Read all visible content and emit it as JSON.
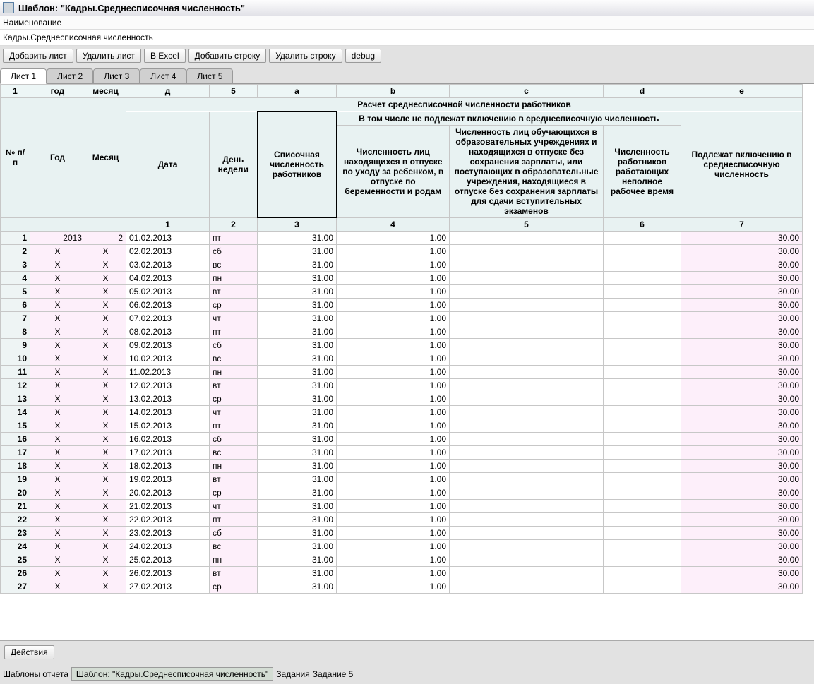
{
  "title": "Шаблон: \"Кадры.Среднесписочная численность\"",
  "name_label": "Наименование",
  "name_value": "Кадры.Среднесписочная численность",
  "toolbar": {
    "add_sheet": "Добавить лист",
    "del_sheet": "Удалить лист",
    "excel": "В Excel",
    "add_row": "Добавить строку",
    "del_row": "Удалить строку",
    "debug": "debug"
  },
  "tabs": [
    "Лист 1",
    "Лист 2",
    "Лист 3",
    "Лист 4",
    "Лист 5"
  ],
  "active_tab": 0,
  "column_letters": [
    "1",
    "год",
    "месяц",
    "д",
    "5",
    "a",
    "b",
    "c",
    "d",
    "e"
  ],
  "main_title": "Расчет среднесписочной численности работников",
  "group_bc_d": "В том числе не подлежат включению в среднесписочную численность",
  "headers": {
    "np": "№ п/п",
    "year": "Год",
    "month": "Месяц",
    "date": "Дата",
    "dow": "День недели",
    "a": "Списочная численность работников",
    "b": "Численность лиц находящихся в отпуске по уходу за ребенком, в отпуске по беременности и родам",
    "c": "Численность лиц обучающихся в образовательных учреждениях и находящихся в отпуске без сохранения зарплаты, или поступающих в образовательные учреждения, находящиеся в отпуске без сохранения зарплаты для сдачи вступительных экзаменов",
    "d": "Численность работников работающих неполное рабочее время",
    "e": "Подлежат включению в среднесписочную численность"
  },
  "subnums": [
    "1",
    "2",
    "3",
    "4",
    "5",
    "6",
    "7"
  ],
  "rows": [
    {
      "n": 1,
      "year": "2013",
      "month": "2",
      "date": "01.02.2013",
      "dow": "пт",
      "a": "31.00",
      "b": "1.00",
      "c": "",
      "d": "",
      "e": "30.00"
    },
    {
      "n": 2,
      "year": "X",
      "month": "X",
      "date": "02.02.2013",
      "dow": "сб",
      "a": "31.00",
      "b": "1.00",
      "c": "",
      "d": "",
      "e": "30.00"
    },
    {
      "n": 3,
      "year": "X",
      "month": "X",
      "date": "03.02.2013",
      "dow": "вс",
      "a": "31.00",
      "b": "1.00",
      "c": "",
      "d": "",
      "e": "30.00"
    },
    {
      "n": 4,
      "year": "X",
      "month": "X",
      "date": "04.02.2013",
      "dow": "пн",
      "a": "31.00",
      "b": "1.00",
      "c": "",
      "d": "",
      "e": "30.00"
    },
    {
      "n": 5,
      "year": "X",
      "month": "X",
      "date": "05.02.2013",
      "dow": "вт",
      "a": "31.00",
      "b": "1.00",
      "c": "",
      "d": "",
      "e": "30.00"
    },
    {
      "n": 6,
      "year": "X",
      "month": "X",
      "date": "06.02.2013",
      "dow": "ср",
      "a": "31.00",
      "b": "1.00",
      "c": "",
      "d": "",
      "e": "30.00"
    },
    {
      "n": 7,
      "year": "X",
      "month": "X",
      "date": "07.02.2013",
      "dow": "чт",
      "a": "31.00",
      "b": "1.00",
      "c": "",
      "d": "",
      "e": "30.00"
    },
    {
      "n": 8,
      "year": "X",
      "month": "X",
      "date": "08.02.2013",
      "dow": "пт",
      "a": "31.00",
      "b": "1.00",
      "c": "",
      "d": "",
      "e": "30.00"
    },
    {
      "n": 9,
      "year": "X",
      "month": "X",
      "date": "09.02.2013",
      "dow": "сб",
      "a": "31.00",
      "b": "1.00",
      "c": "",
      "d": "",
      "e": "30.00"
    },
    {
      "n": 10,
      "year": "X",
      "month": "X",
      "date": "10.02.2013",
      "dow": "вс",
      "a": "31.00",
      "b": "1.00",
      "c": "",
      "d": "",
      "e": "30.00"
    },
    {
      "n": 11,
      "year": "X",
      "month": "X",
      "date": "11.02.2013",
      "dow": "пн",
      "a": "31.00",
      "b": "1.00",
      "c": "",
      "d": "",
      "e": "30.00"
    },
    {
      "n": 12,
      "year": "X",
      "month": "X",
      "date": "12.02.2013",
      "dow": "вт",
      "a": "31.00",
      "b": "1.00",
      "c": "",
      "d": "",
      "e": "30.00"
    },
    {
      "n": 13,
      "year": "X",
      "month": "X",
      "date": "13.02.2013",
      "dow": "ср",
      "a": "31.00",
      "b": "1.00",
      "c": "",
      "d": "",
      "e": "30.00"
    },
    {
      "n": 14,
      "year": "X",
      "month": "X",
      "date": "14.02.2013",
      "dow": "чт",
      "a": "31.00",
      "b": "1.00",
      "c": "",
      "d": "",
      "e": "30.00"
    },
    {
      "n": 15,
      "year": "X",
      "month": "X",
      "date": "15.02.2013",
      "dow": "пт",
      "a": "31.00",
      "b": "1.00",
      "c": "",
      "d": "",
      "e": "30.00"
    },
    {
      "n": 16,
      "year": "X",
      "month": "X",
      "date": "16.02.2013",
      "dow": "сб",
      "a": "31.00",
      "b": "1.00",
      "c": "",
      "d": "",
      "e": "30.00"
    },
    {
      "n": 17,
      "year": "X",
      "month": "X",
      "date": "17.02.2013",
      "dow": "вс",
      "a": "31.00",
      "b": "1.00",
      "c": "",
      "d": "",
      "e": "30.00"
    },
    {
      "n": 18,
      "year": "X",
      "month": "X",
      "date": "18.02.2013",
      "dow": "пн",
      "a": "31.00",
      "b": "1.00",
      "c": "",
      "d": "",
      "e": "30.00"
    },
    {
      "n": 19,
      "year": "X",
      "month": "X",
      "date": "19.02.2013",
      "dow": "вт",
      "a": "31.00",
      "b": "1.00",
      "c": "",
      "d": "",
      "e": "30.00"
    },
    {
      "n": 20,
      "year": "X",
      "month": "X",
      "date": "20.02.2013",
      "dow": "ср",
      "a": "31.00",
      "b": "1.00",
      "c": "",
      "d": "",
      "e": "30.00"
    },
    {
      "n": 21,
      "year": "X",
      "month": "X",
      "date": "21.02.2013",
      "dow": "чт",
      "a": "31.00",
      "b": "1.00",
      "c": "",
      "d": "",
      "e": "30.00"
    },
    {
      "n": 22,
      "year": "X",
      "month": "X",
      "date": "22.02.2013",
      "dow": "пт",
      "a": "31.00",
      "b": "1.00",
      "c": "",
      "d": "",
      "e": "30.00"
    },
    {
      "n": 23,
      "year": "X",
      "month": "X",
      "date": "23.02.2013",
      "dow": "сб",
      "a": "31.00",
      "b": "1.00",
      "c": "",
      "d": "",
      "e": "30.00"
    },
    {
      "n": 24,
      "year": "X",
      "month": "X",
      "date": "24.02.2013",
      "dow": "вс",
      "a": "31.00",
      "b": "1.00",
      "c": "",
      "d": "",
      "e": "30.00"
    },
    {
      "n": 25,
      "year": "X",
      "month": "X",
      "date": "25.02.2013",
      "dow": "пн",
      "a": "31.00",
      "b": "1.00",
      "c": "",
      "d": "",
      "e": "30.00"
    },
    {
      "n": 26,
      "year": "X",
      "month": "X",
      "date": "26.02.2013",
      "dow": "вт",
      "a": "31.00",
      "b": "1.00",
      "c": "",
      "d": "",
      "e": "30.00"
    },
    {
      "n": 27,
      "year": "X",
      "month": "X",
      "date": "27.02.2013",
      "dow": "ср",
      "a": "31.00",
      "b": "1.00",
      "c": "",
      "d": "",
      "e": "30.00"
    }
  ],
  "actions_btn": "Действия",
  "status": {
    "reports": "Шаблоны отчета",
    "current": "Шаблон: \"Кадры.Среднесписочная численность\"",
    "tasks": "Задания",
    "task5": "Задание 5"
  }
}
